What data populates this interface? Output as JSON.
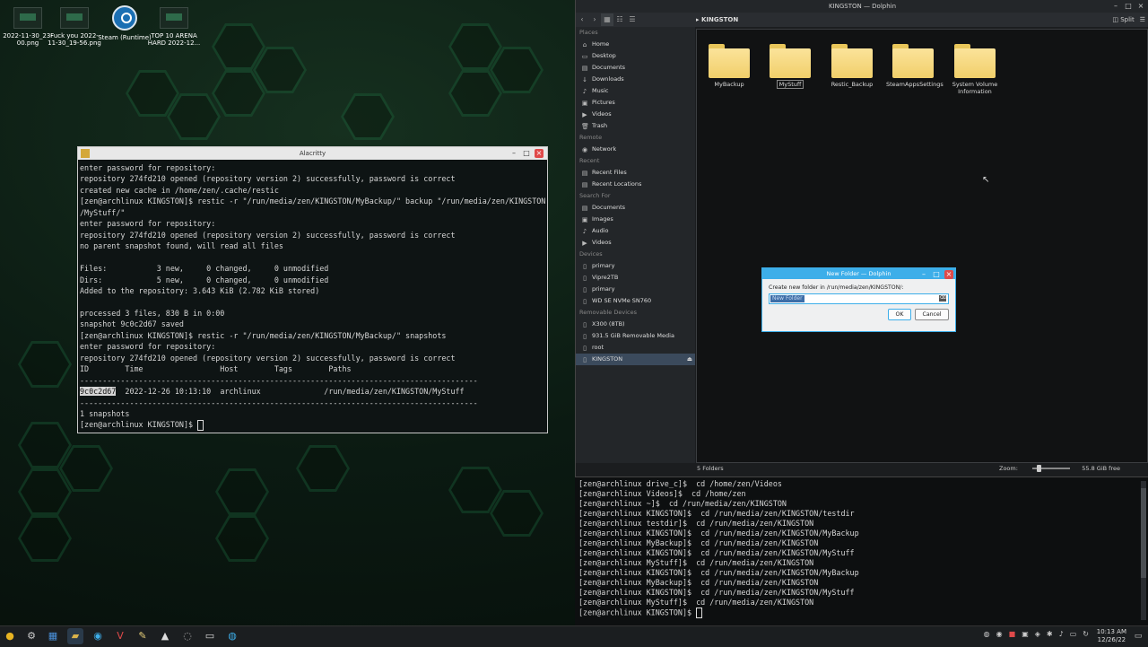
{
  "desktop": {
    "icons": [
      {
        "label": "2022-11-30_23-00.png"
      },
      {
        "label": "Fuck you 2022-11-30_19-56.png"
      },
      {
        "label": "Steam (Runtime)"
      },
      {
        "label": "TOP 10 ARENA HARD 2022-12..."
      }
    ]
  },
  "alacritty": {
    "title": "Alacritty",
    "lines": [
      "enter password for repository:",
      "repository 274fd210 opened (repository version 2) successfully, password is correct",
      "created new cache in /home/zen/.cache/restic",
      "[zen@archlinux KINGSTON]$ restic -r \"/run/media/zen/KINGSTON/MyBackup/\" backup \"/run/media/zen/KINGSTON",
      "/MyStuff/\"",
      "enter password for repository:",
      "repository 274fd210 opened (repository version 2) successfully, password is correct",
      "no parent snapshot found, will read all files",
      "",
      "Files:           3 new,     0 changed,     0 unmodified",
      "Dirs:            5 new,     0 changed,     0 unmodified",
      "Added to the repository: 3.643 KiB (2.782 KiB stored)",
      "",
      "processed 3 files, 830 B in 0:00",
      "snapshot 9c0c2d67 saved",
      "[zen@archlinux KINGSTON]$ restic -r \"/run/media/zen/KINGSTON/MyBackup/\" snapshots",
      "enter password for repository:",
      "repository 274fd210 opened (repository version 2) successfully, password is correct",
      "ID        Time                 Host        Tags        Paths",
      "----------------------------------------------------------------------------------------"
    ],
    "snapshot_id": "9c0c2d67",
    "snapshot_rest": "  2022-12-26 10:13:10  archlinux              /run/media/zen/KINGSTON/MyStuff",
    "lines2": [
      "----------------------------------------------------------------------------------------",
      "1 snapshots"
    ],
    "prompt": "[zen@archlinux KINGSTON]$ "
  },
  "dolphin": {
    "title": "KINGSTON — Dolphin",
    "breadcrumb": "KINGSTON",
    "split_label": "Split",
    "places": [
      {
        "type": "head",
        "label": "Places"
      },
      {
        "type": "item",
        "icon": "home-icon",
        "glyph": "⌂",
        "label": "Home"
      },
      {
        "type": "item",
        "icon": "desktop-icon",
        "glyph": "▭",
        "label": "Desktop"
      },
      {
        "type": "item",
        "icon": "documents-icon",
        "glyph": "▤",
        "label": "Documents"
      },
      {
        "type": "item",
        "icon": "downloads-icon",
        "glyph": "↓",
        "label": "Downloads"
      },
      {
        "type": "item",
        "icon": "music-icon",
        "glyph": "♪",
        "label": "Music"
      },
      {
        "type": "item",
        "icon": "pictures-icon",
        "glyph": "▣",
        "label": "Pictures"
      },
      {
        "type": "item",
        "icon": "videos-icon",
        "glyph": "▶",
        "label": "Videos"
      },
      {
        "type": "item",
        "icon": "trash-icon",
        "glyph": "🗑",
        "label": "Trash"
      },
      {
        "type": "head",
        "label": "Remote"
      },
      {
        "type": "item",
        "icon": "network-icon",
        "glyph": "◉",
        "label": "Network"
      },
      {
        "type": "head",
        "label": "Recent"
      },
      {
        "type": "item",
        "icon": "recent-files-icon",
        "glyph": "▤",
        "label": "Recent Files"
      },
      {
        "type": "item",
        "icon": "recent-locations-icon",
        "glyph": "▤",
        "label": "Recent Locations"
      },
      {
        "type": "head",
        "label": "Search For"
      },
      {
        "type": "item",
        "icon": "documents-icon",
        "glyph": "▤",
        "label": "Documents"
      },
      {
        "type": "item",
        "icon": "images-icon",
        "glyph": "▣",
        "label": "Images"
      },
      {
        "type": "item",
        "icon": "audio-icon",
        "glyph": "♪",
        "label": "Audio"
      },
      {
        "type": "item",
        "icon": "videos-icon",
        "glyph": "▶",
        "label": "Videos"
      },
      {
        "type": "head",
        "label": "Devices"
      },
      {
        "type": "item",
        "icon": "drive-icon",
        "glyph": "▯",
        "label": "primary"
      },
      {
        "type": "item",
        "icon": "drive-icon",
        "glyph": "▯",
        "label": "Vipre2TB"
      },
      {
        "type": "item",
        "icon": "drive-icon",
        "glyph": "▯",
        "label": "primary"
      },
      {
        "type": "item",
        "icon": "drive-icon",
        "glyph": "▯",
        "label": "WD SE NVMe SN760"
      },
      {
        "type": "head",
        "label": "Removable Devices"
      },
      {
        "type": "item",
        "icon": "usb-drive-icon",
        "glyph": "▯",
        "label": "X300 (8TB)"
      },
      {
        "type": "item",
        "icon": "usb-drive-icon",
        "glyph": "▯",
        "label": "931.5 GiB Removable Media"
      },
      {
        "type": "item",
        "icon": "usb-drive-icon",
        "glyph": "▯",
        "label": "root"
      },
      {
        "type": "item",
        "icon": "usb-drive-icon",
        "glyph": "▯",
        "label": "KINGSTON",
        "active": true
      }
    ],
    "folders": [
      {
        "label": "MyBackup"
      },
      {
        "label": "MyStuff",
        "selected": true
      },
      {
        "label": "Restic_Backup"
      },
      {
        "label": "SteamAppsSettings"
      },
      {
        "label": "System Volume Information"
      }
    ],
    "status_count": "5 Folders",
    "zoom_label": "Zoom:",
    "free_space": "55.8 GiB free",
    "terminal_lines": [
      "[zen@archlinux drive_c]$  cd /home/zen/Videos",
      "[zen@archlinux Videos]$  cd /home/zen",
      "[zen@archlinux ~]$  cd /run/media/zen/KINGSTON",
      "[zen@archlinux KINGSTON]$  cd /run/media/zen/KINGSTON/testdir",
      "[zen@archlinux testdir]$  cd /run/media/zen/KINGSTON",
      "[zen@archlinux KINGSTON]$  cd /run/media/zen/KINGSTON/MyBackup",
      "[zen@archlinux MyBackup]$  cd /run/media/zen/KINGSTON",
      "[zen@archlinux KINGSTON]$  cd /run/media/zen/KINGSTON/MyStuff",
      "[zen@archlinux MyStuff]$  cd /run/media/zen/KINGSTON",
      "[zen@archlinux KINGSTON]$  cd /run/media/zen/KINGSTON/MyBackup",
      "[zen@archlinux MyBackup]$  cd /run/media/zen/KINGSTON",
      "[zen@archlinux KINGSTON]$  cd /run/media/zen/KINGSTON/MyStuff",
      "[zen@archlinux MyStuff]$  cd /run/media/zen/KINGSTON"
    ],
    "terminal_prompt": "[zen@archlinux KINGSTON]$ "
  },
  "dialog": {
    "title": "New Folder — Dolphin",
    "message": "Create new folder in /run/media/zen/KINGSTON/:",
    "input_value": "New Folder",
    "ok_label": "OK",
    "cancel_label": "Cancel"
  },
  "taskbar": {
    "time": "10:13 AM",
    "date": "12/26/22"
  }
}
